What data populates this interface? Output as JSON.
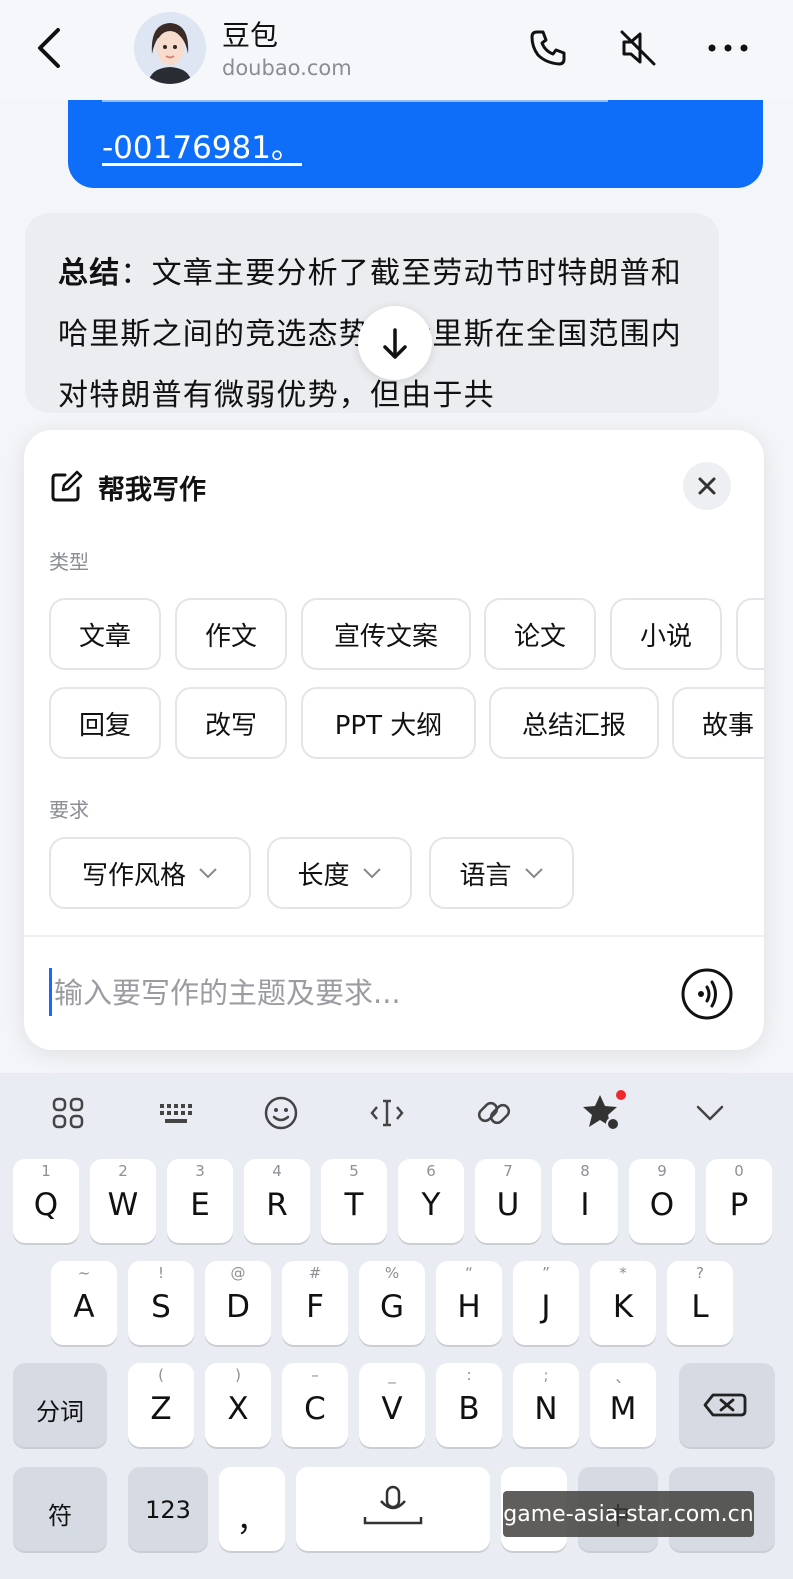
{
  "header": {
    "title": "豆包",
    "subtitle": "doubao.com",
    "icons": [
      "back-icon",
      "phone-icon",
      "speaker-mute-icon",
      "more-icon"
    ]
  },
  "chat": {
    "user_message_tail": "-00176981",
    "user_message_end": "。",
    "bot_label": "总结",
    "bot_text": "：文章主要分析了截至劳动节时特朗普和哈里斯之间的竞选态势。哈里斯在全国范围内对特朗普有微弱优势，但由于共"
  },
  "writing_panel": {
    "title": "帮我写作",
    "type_label": "类型",
    "type_row1": [
      "文章",
      "作文",
      "宣传文案",
      "论文",
      "小说"
    ],
    "type_row2": [
      "回复",
      "改写",
      "PPT 大纲",
      "总结汇报",
      "故事"
    ],
    "requirement_label": "要求",
    "requirements": [
      "写作风格",
      "长度",
      "语言"
    ],
    "input_placeholder": "输入要写作的主题及要求..."
  },
  "keyboard": {
    "row1": [
      {
        "k": "Q",
        "h": "1"
      },
      {
        "k": "W",
        "h": "2"
      },
      {
        "k": "E",
        "h": "3"
      },
      {
        "k": "R",
        "h": "4"
      },
      {
        "k": "T",
        "h": "5"
      },
      {
        "k": "Y",
        "h": "6"
      },
      {
        "k": "U",
        "h": "7"
      },
      {
        "k": "I",
        "h": "8"
      },
      {
        "k": "O",
        "h": "9"
      },
      {
        "k": "P",
        "h": "0"
      }
    ],
    "row2": [
      {
        "k": "A",
        "h": "~"
      },
      {
        "k": "S",
        "h": "!"
      },
      {
        "k": "D",
        "h": "@"
      },
      {
        "k": "F",
        "h": "#"
      },
      {
        "k": "G",
        "h": "%"
      },
      {
        "k": "H",
        "h": "“"
      },
      {
        "k": "J",
        "h": "”"
      },
      {
        "k": "K",
        "h": "*"
      },
      {
        "k": "L",
        "h": "?"
      }
    ],
    "row3": [
      {
        "k": "Z",
        "h": "("
      },
      {
        "k": "X",
        "h": ")"
      },
      {
        "k": "C",
        "h": "–"
      },
      {
        "k": "V",
        "h": "_"
      },
      {
        "k": "B",
        "h": ":"
      },
      {
        "k": "N",
        "h": ";"
      },
      {
        "k": "M",
        "h": "、"
      }
    ],
    "split_key": "分词",
    "symbol_key": "符",
    "number_key": "123",
    "comma_key": "，",
    "chinese_key": "中",
    "toolbar_icons": [
      "apps-icon",
      "keyboard-icon",
      "emoji-icon",
      "cursor-move-icon",
      "clipboard-link-icon",
      "ai-star-icon",
      "collapse-icon"
    ]
  },
  "watermark": "game-asia-star.com.cn"
}
